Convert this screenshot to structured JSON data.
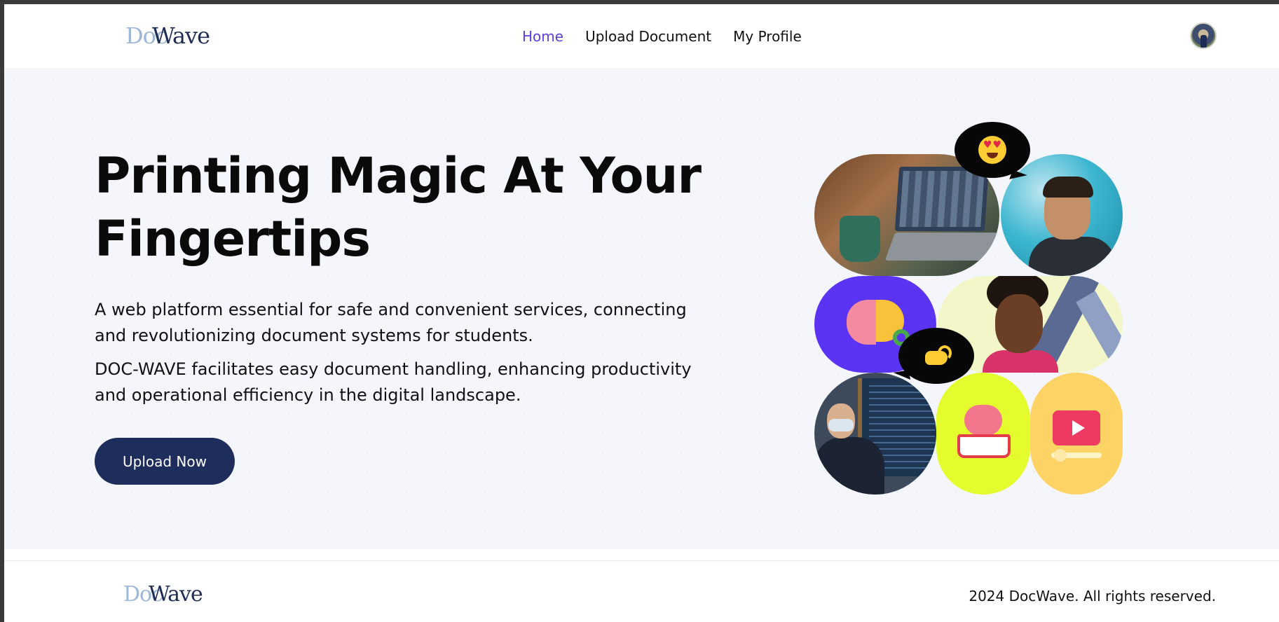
{
  "brand": {
    "logo_part1": "Doc",
    "logo_part2": "Wave",
    "colors": {
      "primary": "#1f2d5c",
      "accent": "#5a3fe0",
      "logo_light": "#9db7d8"
    }
  },
  "nav": {
    "items": [
      {
        "label": "Home",
        "active": true
      },
      {
        "label": "Upload Document",
        "active": false
      },
      {
        "label": "My Profile",
        "active": false
      }
    ]
  },
  "user": {
    "avatar_icon": "user-avatar"
  },
  "hero": {
    "title": "Printing Magic At Your Fingertips",
    "paragraph1": "A web platform essential for safe and convenient services, connecting and revolutionizing document systems for students.",
    "paragraph2": "DOC-WAVE facilitates easy document handling, enhancing productivity and operational efficiency in the digital landscape.",
    "cta_label": "Upload Now"
  },
  "collage": {
    "tiles": [
      "video-call-laptop",
      "laughing-man",
      "brain-bulb-icon",
      "smiling-woman",
      "teacher-whiteboard",
      "brain-book-icon",
      "video-play-icon"
    ],
    "bubbles": [
      "heart-eyes-emoji",
      "pinched-fingers-emoji"
    ]
  },
  "footer": {
    "copyright": "2024 DocWave. All rights reserved."
  }
}
